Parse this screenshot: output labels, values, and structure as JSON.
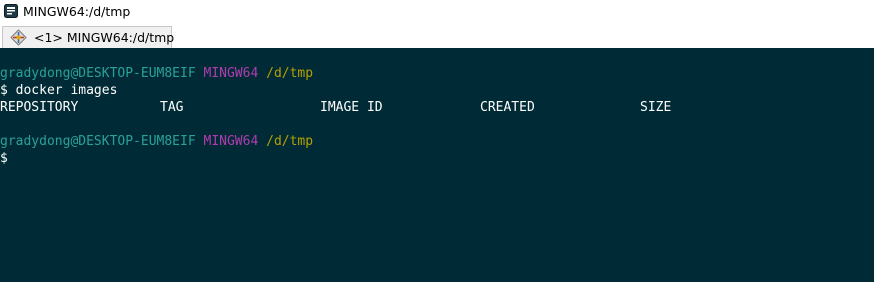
{
  "window": {
    "title": "MINGW64:/d/tmp",
    "app_icon": "terminal-icon"
  },
  "tabs": [
    {
      "label": "<1> MINGW64:/d/tmp",
      "icon": "tab-console-icon"
    }
  ],
  "terminal": {
    "colors": {
      "background": "#002b36",
      "user_host": "#2aa198",
      "msystem": "#b03cb0",
      "path": "#b5a000",
      "text": "#ffffff"
    },
    "prompt1": {
      "user_host": "gradydong@DESKTOP-EUM8EIF",
      "msystem": "MINGW64",
      "path": "/d/tmp"
    },
    "command1": "$ docker images",
    "table_headers": [
      "REPOSITORY",
      "TAG",
      "IMAGE ID",
      "CREATED",
      "SIZE"
    ],
    "prompt2": {
      "user_host": "gradydong@DESKTOP-EUM8EIF",
      "msystem": "MINGW64",
      "path": "/d/tmp"
    },
    "current_input": "$"
  }
}
